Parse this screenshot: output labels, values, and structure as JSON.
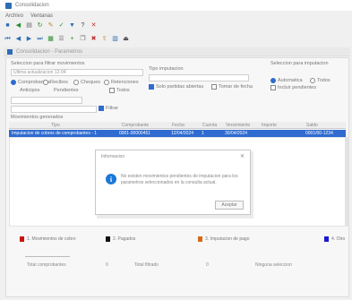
{
  "window": {
    "title": "Consolidacion"
  },
  "menu": {
    "items": [
      "Archivo",
      "Ventanas"
    ]
  },
  "subwindow": {
    "title": "Consolidacion - Parametros"
  },
  "filters": {
    "section1_label": "Seleccion para filtrar movimientos",
    "date_filter_value": "Ultima actualizacion 12-04",
    "radio_options": [
      {
        "label": "Comprobantes",
        "selected": true
      },
      {
        "label": "Recibos",
        "selected": false
      },
      {
        "label": "Cheques",
        "selected": false
      },
      {
        "label": "Retenciones",
        "selected": false
      }
    ],
    "sub_options": [
      "Anticipos",
      "Pendientes",
      "Todos"
    ],
    "combo_value": "",
    "refresh_label": "Filtrar",
    "section2_label": "Tipo imputacion",
    "section2_check_label": "Solo partidas abiertas",
    "section2_check2_label": "Tomar de fecha",
    "section3_label": "Seleccion para imputacion",
    "section3_radio1": "Automatica",
    "section3_radio2": "Todos",
    "section3_check": "Incluir pendientes"
  },
  "grid": {
    "section_label": "Movimientos generados",
    "columns": [
      "Tipo",
      "Comprobante",
      "Fecha",
      "Cuenta",
      "Vencimiento",
      "Importe",
      "Saldo"
    ],
    "selected_row": [
      "Imputacion de cobros de comprobantes - 1",
      "0001-00000451",
      "12/04/2024",
      "1",
      "30/04/2024",
      "",
      "0001/00-1234"
    ]
  },
  "dialog": {
    "title": "Informacion",
    "message": "No existen movimientos pendientes de imputacion para los parametros seleccionados en la consulta actual.",
    "ok_label": "Aceptar"
  },
  "legend": [
    {
      "label": "1. Movimientos de cobro",
      "color": "#cc1111"
    },
    {
      "label": "2. Pagados",
      "color": "#111111"
    },
    {
      "label": "3. Imputacion de pago",
      "color": "#d46a1a"
    },
    {
      "label": "4. Otro",
      "color": "#1b1bd0"
    }
  ],
  "footer": {
    "total_label": "Total comprobantes",
    "total_value": "0",
    "filtered_label": "Total filtrado",
    "filtered_value": "0",
    "status_text": "Ninguna seleccion"
  }
}
